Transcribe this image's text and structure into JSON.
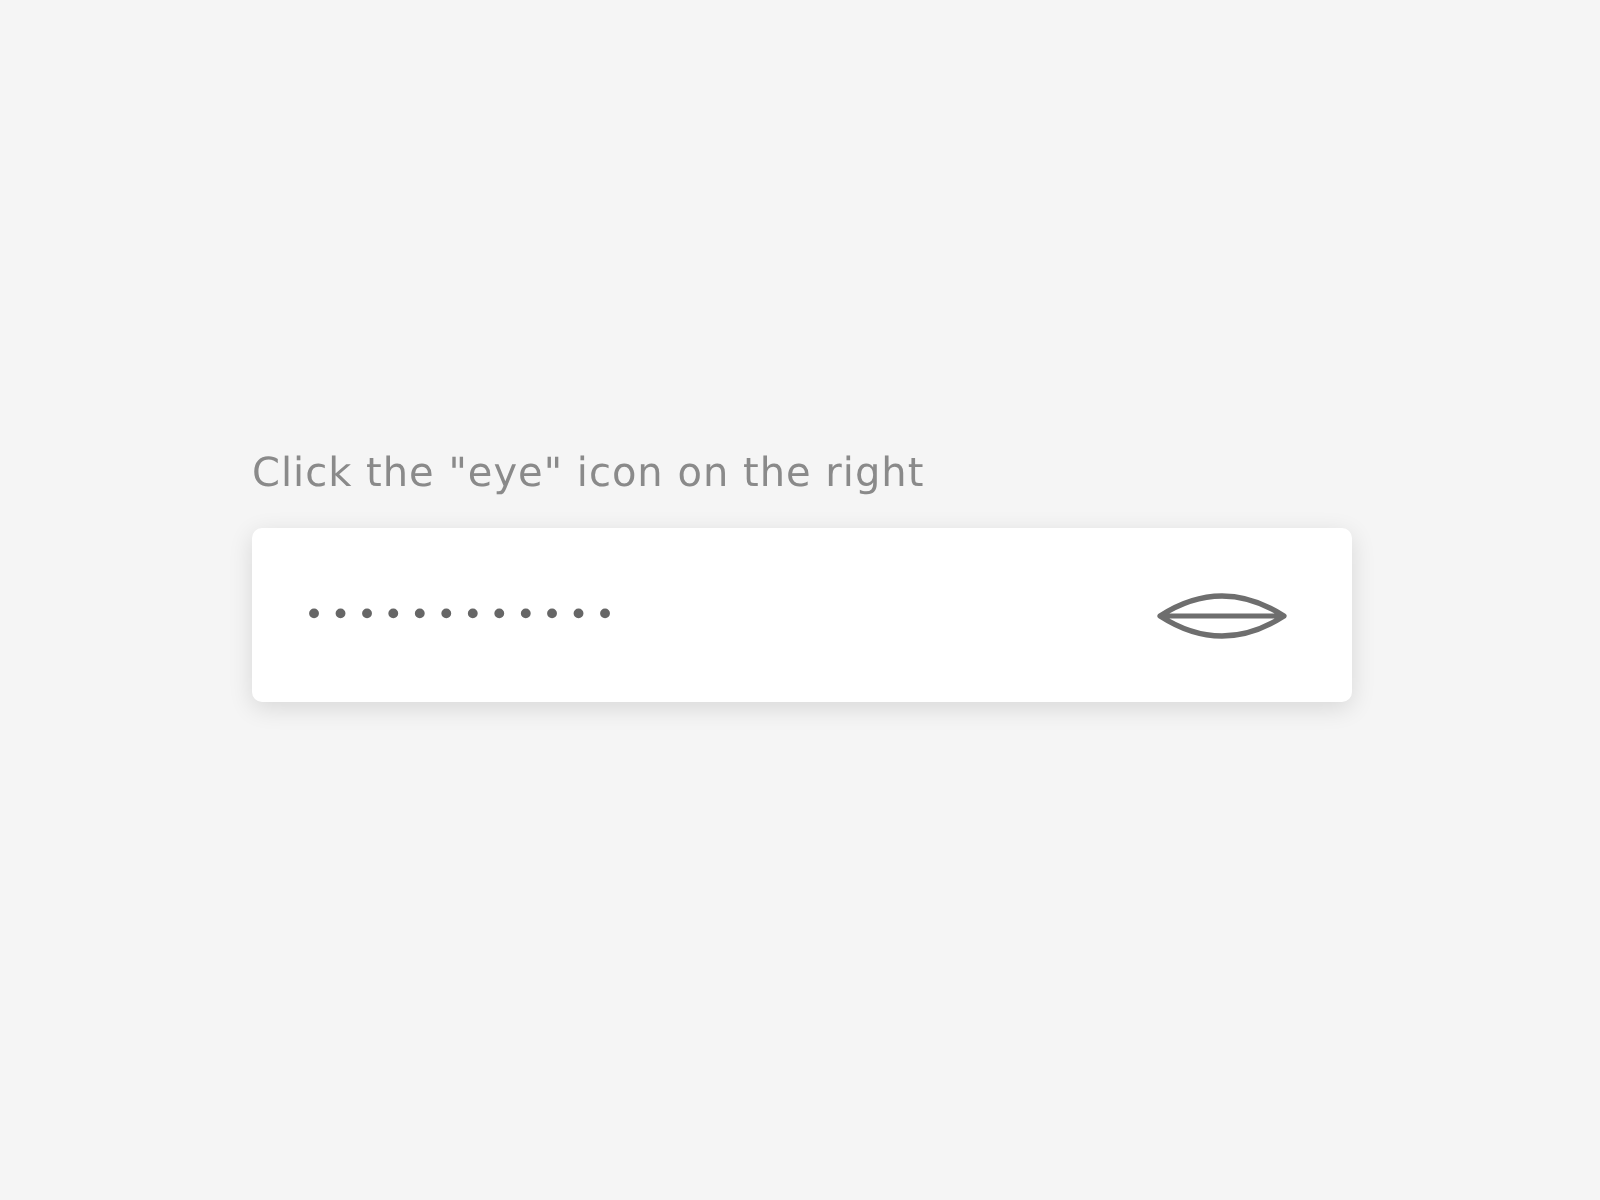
{
  "label": "Click the \"eye\" icon on the right",
  "password_field": {
    "value": "••••••••••••"
  }
}
